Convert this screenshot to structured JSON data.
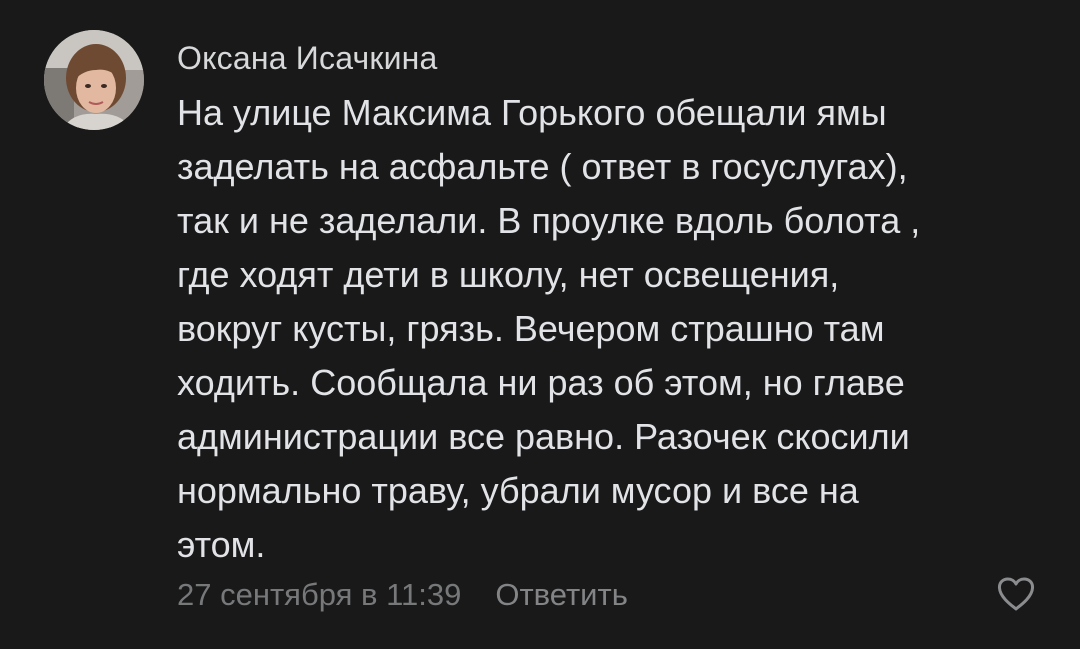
{
  "comment": {
    "author": "Оксана Исачкина",
    "text_lines": [
      "На улице Максима Горького обещали ямы",
      "заделать на асфальте ( ответ в госуслугах),",
      "так и не заделали. В проулке вдоль болота ,",
      "где ходят дети в школу, нет освещения,",
      "вокруг кусты, грязь. Вечером страшно там",
      "ходить. Сообщала ни раз об этом, но главе",
      "администрации все равно. Разочек скосили",
      "нормально траву, убрали мусор и все на",
      "этом."
    ],
    "timestamp": "27 сентября в 11:39",
    "reply_label": "Ответить",
    "avatar_icon": "user-avatar-photo",
    "like_icon": "heart-outline-icon"
  },
  "colors": {
    "background": "#19191a",
    "author": "#d7d8d9",
    "text": "#e1e3e6",
    "meta": "#76787a"
  }
}
